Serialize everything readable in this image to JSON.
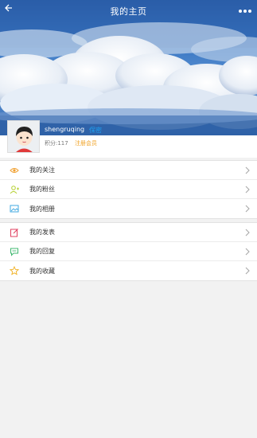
{
  "header": {
    "title": "我的主页"
  },
  "profile": {
    "username": "shengruqing",
    "member_link": "保密",
    "points": "积分:117",
    "register": "注册会员"
  },
  "menu_groups": [
    {
      "items": [
        {
          "label": "我的关注",
          "icon": "eye-icon",
          "color": "#f0a030"
        },
        {
          "label": "我的粉丝",
          "icon": "user-add-icon",
          "color": "#b4d030"
        },
        {
          "label": "我的相册",
          "icon": "image-icon",
          "color": "#40a8e0"
        }
      ]
    },
    {
      "items": [
        {
          "label": "我的发表",
          "icon": "edit-icon",
          "color": "#e04060"
        },
        {
          "label": "我的回复",
          "icon": "comment-icon",
          "color": "#40b870"
        },
        {
          "label": "我的收藏",
          "icon": "star-icon",
          "color": "#f0b020"
        }
      ]
    }
  ]
}
